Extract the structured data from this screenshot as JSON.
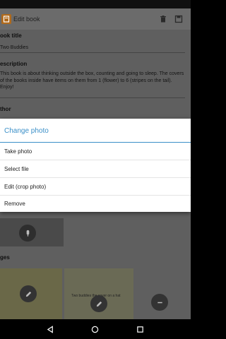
{
  "actionbar": {
    "title": "Edit book",
    "icons": [
      "book-icon",
      "trash-icon",
      "save-icon"
    ]
  },
  "form": {
    "title_label": "ook title",
    "title_value": "Two Buddies",
    "description_label": "escription",
    "description_value": "This book is about thinking outside the box, counting and going to sleep. The covers of the books inside have items on them from 1 (flower) to 6 (stripes on the tail). Enjoy!",
    "author_label": "thor",
    "images_label": "ges",
    "thumb2_caption": "Two buddies the cover on a hat"
  },
  "dialog": {
    "title": "Change photo",
    "options": [
      {
        "label": "Take photo"
      },
      {
        "label": "Select file"
      },
      {
        "label": "Edit (crop photo)"
      },
      {
        "label": "Remove"
      }
    ]
  },
  "colors": {
    "accent": "#3a8fc8",
    "actionbar": "#6b6b6b",
    "dim_background": "#5f5f5f"
  },
  "navbar": {
    "icons": [
      "back-icon",
      "home-icon",
      "recents-icon"
    ]
  }
}
